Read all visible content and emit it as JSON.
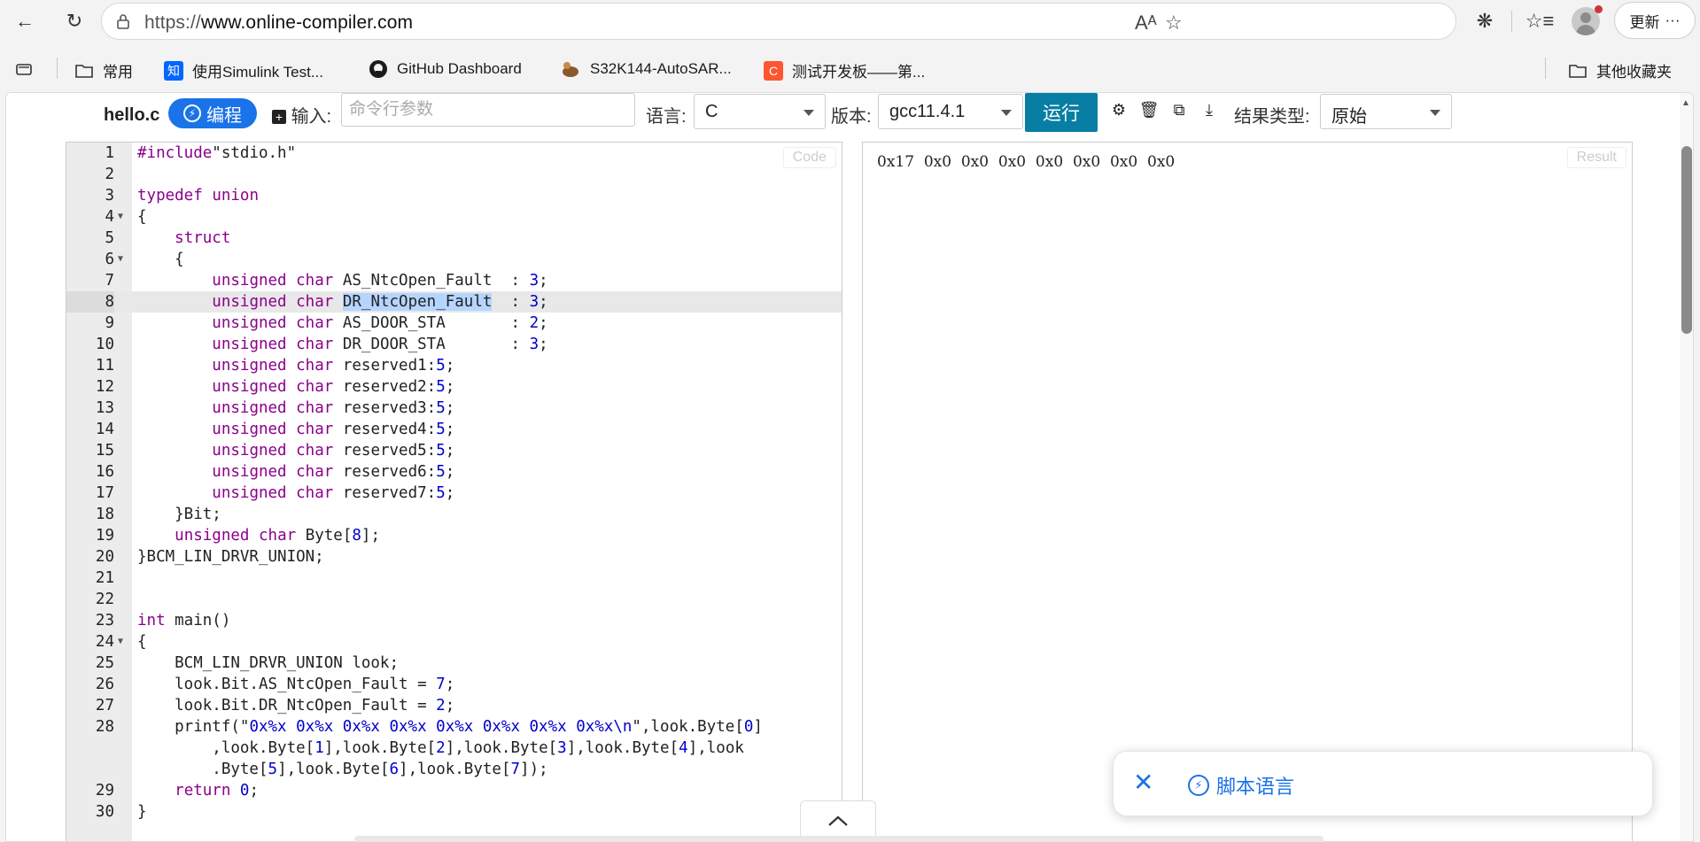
{
  "browser": {
    "url_scheme": "https://",
    "url_host": "www.online-compiler.com",
    "update_label": "更新",
    "more_label": "···"
  },
  "bookmarks": [
    {
      "label": "常用",
      "icon": "folder-icon"
    },
    {
      "label": "使用Simulink Test...",
      "icon": "zhihu-icon",
      "glyph": "知",
      "color": "#0066ff"
    },
    {
      "label": "GitHub Dashboard",
      "icon": "github-icon"
    },
    {
      "label": "S32K144-AutoSAR...",
      "icon": "site-icon"
    },
    {
      "label": "测试开发板——第...",
      "icon": "csdn-icon",
      "glyph": "C",
      "color": "#fc5531"
    }
  ],
  "other_bookmarks_label": "其他收藏夹",
  "app": {
    "filename": "hello.c",
    "code_button_label": "编程",
    "input_label": "输入:",
    "args_placeholder": "命令行参数",
    "language_label": "语言:",
    "language_value": "C",
    "version_label": "版本:",
    "version_value": "gcc11.4.1",
    "run_label": "运行",
    "result_type_label": "结果类型:",
    "result_type_value": "原始",
    "code_tag": "Code",
    "result_tag": "Result"
  },
  "code_lines": [
    {
      "n": "1",
      "text": "#include\"stdio.h\""
    },
    {
      "n": "2",
      "text": ""
    },
    {
      "n": "3",
      "text": "typedef union"
    },
    {
      "n": "4",
      "text": "{"
    },
    {
      "n": "5",
      "text": "    struct"
    },
    {
      "n": "6",
      "text": "    {"
    },
    {
      "n": "7",
      "text": "        unsigned char AS_NtcOpen_Fault  : 3;"
    },
    {
      "n": "8",
      "text": "        unsigned char DR_NtcOpen_Fault  : 3;"
    },
    {
      "n": "9",
      "text": "        unsigned char AS_DOOR_STA       : 2;"
    },
    {
      "n": "10",
      "text": "        unsigned char DR_DOOR_STA       : 3;"
    },
    {
      "n": "11",
      "text": "        unsigned char reserved1:5;"
    },
    {
      "n": "12",
      "text": "        unsigned char reserved2:5;"
    },
    {
      "n": "13",
      "text": "        unsigned char reserved3:5;"
    },
    {
      "n": "14",
      "text": "        unsigned char reserved4:5;"
    },
    {
      "n": "15",
      "text": "        unsigned char reserved5:5;"
    },
    {
      "n": "16",
      "text": "        unsigned char reserved6:5;"
    },
    {
      "n": "17",
      "text": "        unsigned char reserved7:5;"
    },
    {
      "n": "18",
      "text": "    }Bit;"
    },
    {
      "n": "19",
      "text": "    unsigned char Byte[8];"
    },
    {
      "n": "20",
      "text": "}BCM_LIN_DRVR_UNION;"
    },
    {
      "n": "21",
      "text": ""
    },
    {
      "n": "22",
      "text": ""
    },
    {
      "n": "23",
      "text": "int main()"
    },
    {
      "n": "24",
      "text": "{"
    },
    {
      "n": "25",
      "text": "    BCM_LIN_DRVR_UNION look;"
    },
    {
      "n": "26",
      "text": "    look.Bit.AS_NtcOpen_Fault = 7;"
    },
    {
      "n": "27",
      "text": "    look.Bit.DR_NtcOpen_Fault = 2;"
    },
    {
      "n": "28",
      "text": "    printf(\"0x%x 0x%x 0x%x 0x%x 0x%x 0x%x 0x%x 0x%x\\n\",look.Byte[0]\n        ,look.Byte[1],look.Byte[2],look.Byte[3],look.Byte[4],look\n        .Byte[5],look.Byte[6],look.Byte[7]);"
    },
    {
      "n": "29",
      "text": "    return 0;"
    },
    {
      "n": "30",
      "text": "}"
    }
  ],
  "result_output": "0x17  0x0  0x0  0x0  0x0  0x0  0x0  0x0",
  "popup": {
    "close_label": "✕",
    "label": "脚本语言"
  }
}
